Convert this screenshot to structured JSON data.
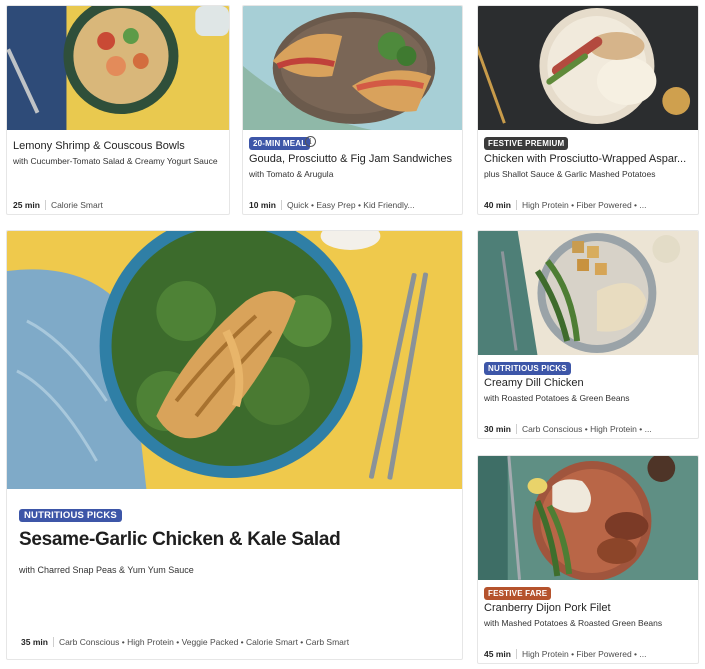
{
  "cards": [
    {
      "title": "Lemony Shrimp & Couscous Bowls",
      "subtitle": "with Cucumber-Tomato Salad & Creamy Yogurt Sauce",
      "time": "25 min",
      "tags": "Calorie Smart",
      "badge": null
    },
    {
      "title": "Gouda, Prosciutto & Fig Jam Sandwiches",
      "subtitle": "with Tomato & Arugula",
      "time": "10 min",
      "tags": "Quick • Easy Prep • Kid Friendly...",
      "badge": "20-MIN MEAL",
      "info_icon": "i"
    },
    {
      "title": "Chicken with Prosciutto-Wrapped Aspar...",
      "subtitle": "plus Shallot Sauce & Garlic Mashed Potatoes",
      "time": "40 min",
      "tags": "High Protein • Fiber Powered • ...",
      "badge": "FESTIVE PREMIUM"
    },
    {
      "title": "Sesame-Garlic Chicken & Kale Salad",
      "subtitle": "with Charred Snap Peas & Yum Yum Sauce",
      "time": "35 min",
      "tags": "Carb Conscious • High Protein • Veggie Packed • Calorie Smart • Carb Smart",
      "badge": "NUTRITIOUS PICKS"
    },
    {
      "title": "Creamy Dill Chicken",
      "subtitle": "with Roasted Potatoes & Green Beans",
      "time": "30 min",
      "tags": "Carb Conscious • High Protein • ...",
      "badge": "NUTRITIOUS PICKS"
    },
    {
      "title": "Cranberry Dijon Pork Filet",
      "subtitle": "with Mashed Potatoes & Roasted Green Beans",
      "time": "45 min",
      "tags": "High Protein • Fiber Powered • ...",
      "badge": "FESTIVE FARE"
    }
  ],
  "colors": {
    "badge_blue": "#3d56a8",
    "badge_dark": "#3a3a3a",
    "badge_festive": "#b5532d"
  }
}
